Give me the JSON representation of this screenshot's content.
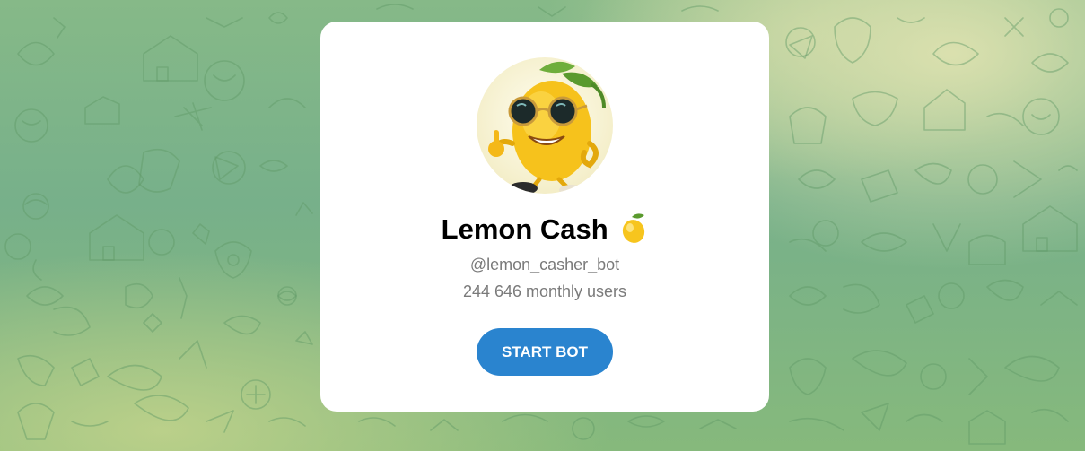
{
  "bot": {
    "name": "Lemon Cash",
    "title_emoji": "lemon-emoji",
    "username": "@lemon_casher_bot",
    "monthly_users": "244 646 monthly users",
    "avatar": "lemon-mascot-avatar"
  },
  "actions": {
    "start_label": "START BOT"
  },
  "colors": {
    "button": "#2a84cf",
    "card": "#ffffff",
    "background_green": "#77b08a",
    "background_yellow": "#dee2b0"
  }
}
